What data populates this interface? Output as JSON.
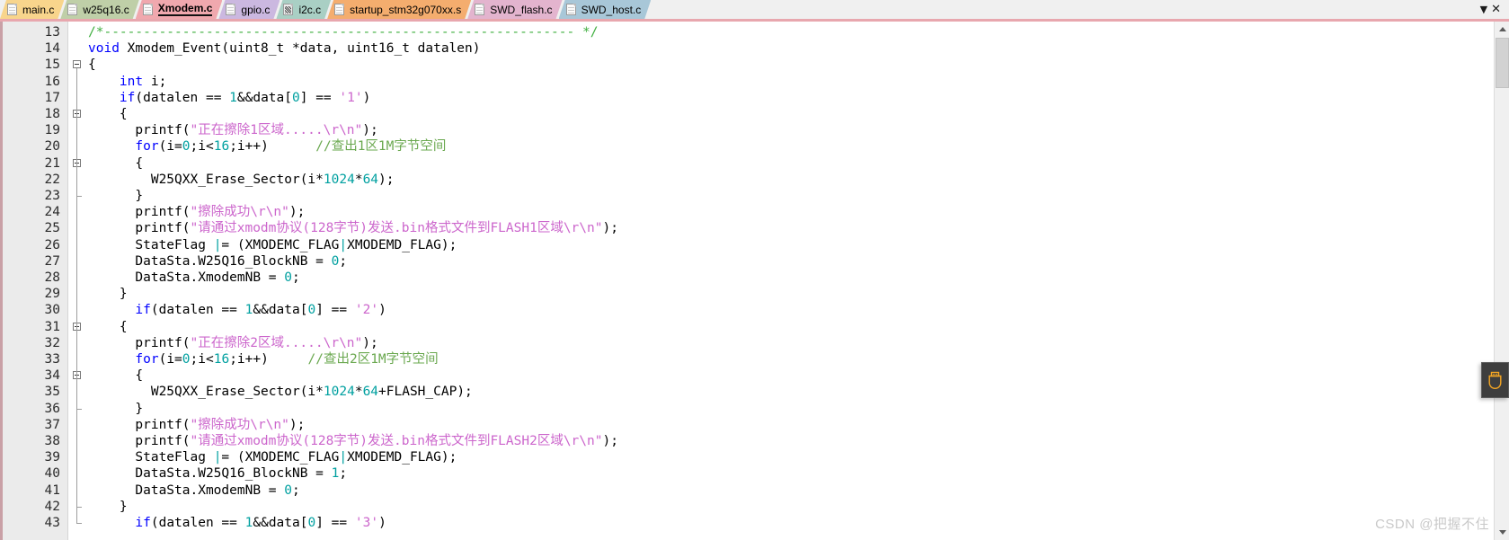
{
  "tabbar": {
    "tabs": [
      {
        "label": "main.c",
        "color": "#f8d58c",
        "icon": "file-icon",
        "active": false,
        "kind": "c"
      },
      {
        "label": "w25q16.c",
        "color": "#bfcfa8",
        "icon": "file-icon",
        "active": false,
        "kind": "c"
      },
      {
        "label": "Xmodem.c",
        "color": "#f0a8ae",
        "icon": "file-icon",
        "active": true,
        "kind": "c"
      },
      {
        "label": "gpio.c",
        "color": "#cbb8e0",
        "icon": "file-icon",
        "active": false,
        "kind": "c"
      },
      {
        "label": "i2c.c",
        "color": "#a9cfc4",
        "icon": "assembly-file-icon",
        "active": false,
        "kind": "asm"
      },
      {
        "label": "startup_stm32g070xx.s",
        "color": "#f4ad6e",
        "icon": "file-icon",
        "active": false,
        "kind": "c"
      },
      {
        "label": "SWD_flash.c",
        "color": "#e3b4ce",
        "icon": "file-icon",
        "active": false,
        "kind": "c"
      },
      {
        "label": "SWD_host.c",
        "color": "#a8c7d8",
        "icon": "file-icon",
        "active": false,
        "kind": "c"
      }
    ],
    "controls": {
      "dropdown": "▼",
      "close": "✕"
    }
  },
  "editor": {
    "first_line": 13,
    "lines": [
      {
        "n": 13,
        "fold": null,
        "tokens": [
          {
            "t": "/*------------------------------------------------------------ */",
            "c": "cmt"
          }
        ]
      },
      {
        "n": 14,
        "fold": null,
        "tokens": [
          {
            "t": "void ",
            "c": "kw"
          },
          {
            "t": "Xmodem_Event(uint8_t *data, uint16_t datalen)",
            "c": "op"
          }
        ]
      },
      {
        "n": 15,
        "fold": "open",
        "tokens": [
          {
            "t": "{",
            "c": "op"
          }
        ]
      },
      {
        "n": 16,
        "fold": null,
        "tokens": [
          {
            "t": "    ",
            "c": "op"
          },
          {
            "t": "int",
            "c": "kw"
          },
          {
            "t": " i;",
            "c": "op"
          }
        ]
      },
      {
        "n": 17,
        "fold": null,
        "tokens": [
          {
            "t": "    ",
            "c": "op"
          },
          {
            "t": "if",
            "c": "kw"
          },
          {
            "t": "(datalen == ",
            "c": "op"
          },
          {
            "t": "1",
            "c": "num"
          },
          {
            "t": "&&data[",
            "c": "op"
          },
          {
            "t": "0",
            "c": "num"
          },
          {
            "t": "] == ",
            "c": "op"
          },
          {
            "t": "'1'",
            "c": "str"
          },
          {
            "t": ")",
            "c": "op"
          }
        ]
      },
      {
        "n": 18,
        "fold": "open",
        "tokens": [
          {
            "t": "    {",
            "c": "op"
          }
        ]
      },
      {
        "n": 19,
        "fold": null,
        "tokens": [
          {
            "t": "      printf(",
            "c": "op"
          },
          {
            "t": "\"正在擦除1区域.....\\r\\n\"",
            "c": "str"
          },
          {
            "t": ");",
            "c": "op"
          }
        ]
      },
      {
        "n": 20,
        "fold": null,
        "tokens": [
          {
            "t": "      ",
            "c": "op"
          },
          {
            "t": "for",
            "c": "kw"
          },
          {
            "t": "(i=",
            "c": "op"
          },
          {
            "t": "0",
            "c": "num"
          },
          {
            "t": ";i<",
            "c": "op"
          },
          {
            "t": "16",
            "c": "num"
          },
          {
            "t": ";i++)      ",
            "c": "op"
          },
          {
            "t": "//查出1区1M字节空间",
            "c": "cmtline"
          }
        ]
      },
      {
        "n": 21,
        "fold": "open",
        "tokens": [
          {
            "t": "      {",
            "c": "op"
          }
        ]
      },
      {
        "n": 22,
        "fold": null,
        "tokens": [
          {
            "t": "        W25QXX_Erase_Sector(i*",
            "c": "op"
          },
          {
            "t": "1024",
            "c": "num"
          },
          {
            "t": "*",
            "c": "op"
          },
          {
            "t": "64",
            "c": "num"
          },
          {
            "t": ");",
            "c": "op"
          }
        ]
      },
      {
        "n": 23,
        "fold": null,
        "tokens": [
          {
            "t": "      }",
            "c": "op"
          }
        ]
      },
      {
        "n": 24,
        "fold": null,
        "tokens": [
          {
            "t": "      printf(",
            "c": "op"
          },
          {
            "t": "\"擦除成功\\r\\n\"",
            "c": "str"
          },
          {
            "t": ");",
            "c": "op"
          }
        ]
      },
      {
        "n": 25,
        "fold": null,
        "tokens": [
          {
            "t": "      printf(",
            "c": "op"
          },
          {
            "t": "\"请通过xmodm协议(128字节)发送.bin格式文件到FLASH1区域\\r\\n\"",
            "c": "str"
          },
          {
            "t": ");",
            "c": "op"
          }
        ]
      },
      {
        "n": 26,
        "fold": null,
        "tokens": [
          {
            "t": "      StateFlag ",
            "c": "op"
          },
          {
            "t": "|",
            "c": "num"
          },
          {
            "t": "= (XMODEMC_FLAG",
            "c": "op"
          },
          {
            "t": "|",
            "c": "num"
          },
          {
            "t": "XMODEMD_FLAG);",
            "c": "op"
          }
        ]
      },
      {
        "n": 27,
        "fold": null,
        "tokens": [
          {
            "t": "      DataSta.W25Q16_BlockNB = ",
            "c": "op"
          },
          {
            "t": "0",
            "c": "num"
          },
          {
            "t": ";",
            "c": "op"
          }
        ]
      },
      {
        "n": 28,
        "fold": null,
        "tokens": [
          {
            "t": "      DataSta.XmodemNB = ",
            "c": "op"
          },
          {
            "t": "0",
            "c": "num"
          },
          {
            "t": ";",
            "c": "op"
          }
        ]
      },
      {
        "n": 29,
        "fold": null,
        "tokens": [
          {
            "t": "    }",
            "c": "op"
          }
        ]
      },
      {
        "n": 30,
        "fold": null,
        "tokens": [
          {
            "t": "      ",
            "c": "op"
          },
          {
            "t": "if",
            "c": "kw"
          },
          {
            "t": "(datalen == ",
            "c": "op"
          },
          {
            "t": "1",
            "c": "num"
          },
          {
            "t": "&&data[",
            "c": "op"
          },
          {
            "t": "0",
            "c": "num"
          },
          {
            "t": "] == ",
            "c": "op"
          },
          {
            "t": "'2'",
            "c": "str"
          },
          {
            "t": ")",
            "c": "op"
          }
        ]
      },
      {
        "n": 31,
        "fold": "open",
        "tokens": [
          {
            "t": "    {",
            "c": "op"
          }
        ]
      },
      {
        "n": 32,
        "fold": null,
        "tokens": [
          {
            "t": "      printf(",
            "c": "op"
          },
          {
            "t": "\"正在擦除2区域.....\\r\\n\"",
            "c": "str"
          },
          {
            "t": ");",
            "c": "op"
          }
        ]
      },
      {
        "n": 33,
        "fold": null,
        "tokens": [
          {
            "t": "      ",
            "c": "op"
          },
          {
            "t": "for",
            "c": "kw"
          },
          {
            "t": "(i=",
            "c": "op"
          },
          {
            "t": "0",
            "c": "num"
          },
          {
            "t": ";i<",
            "c": "op"
          },
          {
            "t": "16",
            "c": "num"
          },
          {
            "t": ";i++)     ",
            "c": "op"
          },
          {
            "t": "//查出2区1M字节空间",
            "c": "cmtline"
          }
        ]
      },
      {
        "n": 34,
        "fold": "open",
        "tokens": [
          {
            "t": "      {",
            "c": "op"
          }
        ]
      },
      {
        "n": 35,
        "fold": null,
        "tokens": [
          {
            "t": "        W25QXX_Erase_Sector(i*",
            "c": "op"
          },
          {
            "t": "1024",
            "c": "num"
          },
          {
            "t": "*",
            "c": "op"
          },
          {
            "t": "64",
            "c": "num"
          },
          {
            "t": "+FLASH_CAP);",
            "c": "op"
          }
        ]
      },
      {
        "n": 36,
        "fold": null,
        "tokens": [
          {
            "t": "      }",
            "c": "op"
          }
        ]
      },
      {
        "n": 37,
        "fold": null,
        "tokens": [
          {
            "t": "      printf(",
            "c": "op"
          },
          {
            "t": "\"擦除成功\\r\\n\"",
            "c": "str"
          },
          {
            "t": ");",
            "c": "op"
          }
        ]
      },
      {
        "n": 38,
        "fold": null,
        "tokens": [
          {
            "t": "      printf(",
            "c": "op"
          },
          {
            "t": "\"请通过xmodm协议(128字节)发送.bin格式文件到FLASH2区域\\r\\n\"",
            "c": "str"
          },
          {
            "t": ");",
            "c": "op"
          }
        ]
      },
      {
        "n": 39,
        "fold": null,
        "tokens": [
          {
            "t": "      StateFlag ",
            "c": "op"
          },
          {
            "t": "|",
            "c": "num"
          },
          {
            "t": "= (XMODEMC_FLAG",
            "c": "op"
          },
          {
            "t": "|",
            "c": "num"
          },
          {
            "t": "XMODEMD_FLAG);",
            "c": "op"
          }
        ]
      },
      {
        "n": 40,
        "fold": null,
        "tokens": [
          {
            "t": "      DataSta.W25Q16_BlockNB = ",
            "c": "op"
          },
          {
            "t": "1",
            "c": "num"
          },
          {
            "t": ";",
            "c": "op"
          }
        ]
      },
      {
        "n": 41,
        "fold": null,
        "tokens": [
          {
            "t": "      DataSta.XmodemNB = ",
            "c": "op"
          },
          {
            "t": "0",
            "c": "num"
          },
          {
            "t": ";",
            "c": "op"
          }
        ]
      },
      {
        "n": 42,
        "fold": "tick",
        "tokens": [
          {
            "t": "    }",
            "c": "op"
          }
        ]
      },
      {
        "n": 43,
        "fold": null,
        "tokens": [
          {
            "t": "      ",
            "c": "op"
          },
          {
            "t": "if",
            "c": "kw"
          },
          {
            "t": "(datalen == ",
            "c": "op"
          },
          {
            "t": "1",
            "c": "num"
          },
          {
            "t": "&&data[",
            "c": "op"
          },
          {
            "t": "0",
            "c": "num"
          },
          {
            "t": "] == ",
            "c": "op"
          },
          {
            "t": "'3'",
            "c": "str"
          },
          {
            "t": ")",
            "c": "op"
          }
        ]
      }
    ]
  },
  "scrollbar": {
    "up_arrow": "▲",
    "down_arrow": "▼"
  },
  "usb_panel": {
    "icon": "usb-drive-icon",
    "icon_color": "#f5a623"
  },
  "watermark": {
    "text": "CSDN @把握不住"
  }
}
